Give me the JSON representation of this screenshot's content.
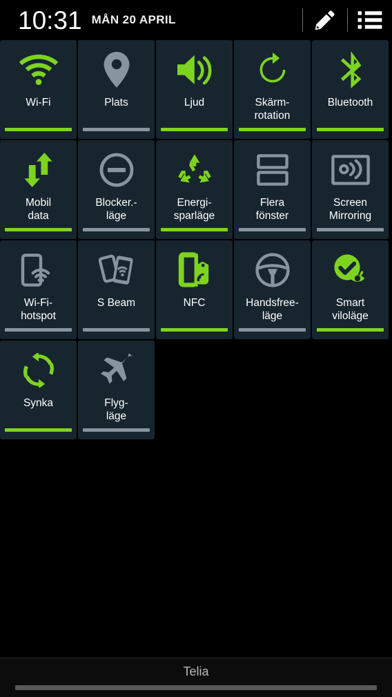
{
  "statusbar": {
    "time": "10:31",
    "date": "MÅN 20 APRIL",
    "edit_icon": "pencil-icon",
    "list_icon": "list-icon"
  },
  "colors": {
    "active": "#7ed321",
    "inactive": "#8795a1",
    "tile_bg": "#17252f",
    "page_bg": "#000000",
    "label": "#ffffff"
  },
  "quick_settings": {
    "tiles": [
      {
        "label": "Wi-Fi",
        "icon": "wifi-icon",
        "state": "on"
      },
      {
        "label": "Plats",
        "icon": "location-pin-icon",
        "state": "off"
      },
      {
        "label": "Ljud",
        "icon": "sound-speaker-icon",
        "state": "on"
      },
      {
        "label": "Skärm-\nrotation",
        "icon": "screen-rotation-icon",
        "state": "on"
      },
      {
        "label": "Bluetooth",
        "icon": "bluetooth-icon",
        "state": "on"
      },
      {
        "label": "Mobil\ndata",
        "icon": "mobile-data-icon",
        "state": "on"
      },
      {
        "label": "Blocker.-\nläge",
        "icon": "blocking-mode-icon",
        "state": "off"
      },
      {
        "label": "Energi-\nsparläge",
        "icon": "power-saving-icon",
        "state": "on"
      },
      {
        "label": "Flera\nfönster",
        "icon": "multi-window-icon",
        "state": "off"
      },
      {
        "label": "Screen\nMirroring",
        "icon": "screen-mirroring-icon",
        "state": "off"
      },
      {
        "label": "Wi-Fi-\nhotspot",
        "icon": "wifi-hotspot-icon",
        "state": "off"
      },
      {
        "label": "S Beam",
        "icon": "s-beam-icon",
        "state": "off"
      },
      {
        "label": "NFC",
        "icon": "nfc-icon",
        "state": "on"
      },
      {
        "label": "Handsfree-\nläge",
        "icon": "steering-wheel-icon",
        "state": "off"
      },
      {
        "label": "Smart\nviloläge",
        "icon": "smart-stay-icon",
        "state": "on"
      },
      {
        "label": "Synka",
        "icon": "sync-icon",
        "state": "on"
      },
      {
        "label": "Flyg-\nläge",
        "icon": "airplane-icon",
        "state": "off"
      }
    ]
  },
  "footer": {
    "carrier": "Telia",
    "handle": "drag-handle"
  }
}
